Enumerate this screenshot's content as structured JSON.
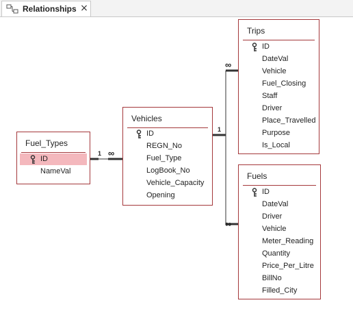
{
  "tab": {
    "title": "Relationships",
    "close_glyph": "×"
  },
  "tables": {
    "fuel_types": {
      "title": "Fuel_Types",
      "fields": [
        {
          "name": "ID",
          "key": true,
          "selected": true
        },
        {
          "name": "NameVal",
          "key": false,
          "selected": false
        }
      ]
    },
    "vehicles": {
      "title": "Vehicles",
      "fields": [
        {
          "name": "ID",
          "key": true
        },
        {
          "name": "REGN_No"
        },
        {
          "name": "Fuel_Type"
        },
        {
          "name": "LogBook_No"
        },
        {
          "name": "Vehicle_Capacity"
        },
        {
          "name": "Opening"
        }
      ]
    },
    "trips": {
      "title": "Trips",
      "fields": [
        {
          "name": "ID",
          "key": true
        },
        {
          "name": "DateVal"
        },
        {
          "name": "Vehicle"
        },
        {
          "name": "Fuel_Closing"
        },
        {
          "name": "Staff"
        },
        {
          "name": "Driver"
        },
        {
          "name": "Place_Travelled"
        },
        {
          "name": "Purpose"
        },
        {
          "name": "Is_Local"
        }
      ]
    },
    "fuels": {
      "title": "Fuels",
      "fields": [
        {
          "name": "ID",
          "key": true
        },
        {
          "name": "DateVal"
        },
        {
          "name": "Driver"
        },
        {
          "name": "Vehicle"
        },
        {
          "name": "Meter_Reading"
        },
        {
          "name": "Quantity"
        },
        {
          "name": "Price_Per_Litre"
        },
        {
          "name": "BillNo"
        },
        {
          "name": "Filled_City"
        }
      ]
    }
  },
  "relationships": {
    "one_label": "1",
    "many_label": "∞"
  },
  "colors": {
    "table_border": "#a4373a",
    "selection": "#f4b8bd",
    "line": "#333333"
  },
  "icons": {
    "tab": "relationships-icon",
    "key": "primary-key-icon",
    "close": "close-icon"
  }
}
